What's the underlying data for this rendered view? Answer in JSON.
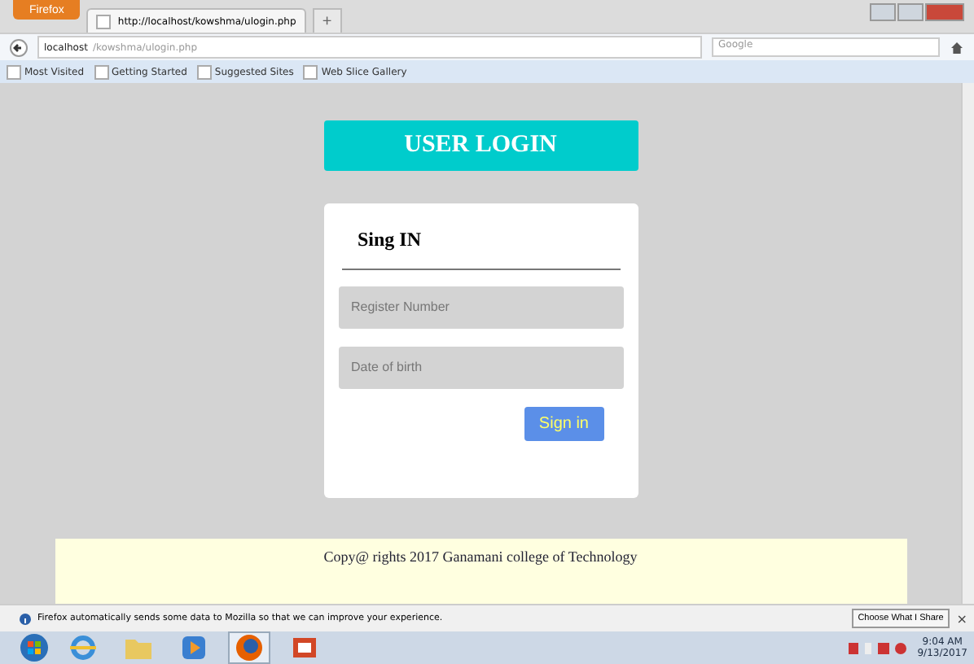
{
  "browser": {
    "menu_button": "Firefox",
    "tab": {
      "title": "http://localhost/kowshma/ulogin.php"
    },
    "new_tab": "+",
    "address": {
      "host": "localhost",
      "path": "/kowshma/ulogin.php"
    },
    "search": {
      "placeholder": "Google"
    },
    "bookmarks": [
      "Most Visited",
      "Getting Started",
      "Suggested Sites",
      "Web Slice Gallery"
    ]
  },
  "page": {
    "banner": "USER LOGIN",
    "card": {
      "heading": "Sing IN",
      "fields": [
        {
          "placeholder": "Register Number"
        },
        {
          "placeholder": "Date of birth"
        }
      ],
      "button": "Sign in"
    },
    "footer": "Copy@ rights 2017 Ganamani college of Technology"
  },
  "notification": {
    "text": "Firefox automatically sends some data to Mozilla so that we can improve your experience.",
    "button": "Choose What I Share",
    "close": "×"
  },
  "taskbar": {
    "apps": [
      {
        "kind": "ie",
        "selected": false
      },
      {
        "kind": "folder",
        "selected": false
      },
      {
        "kind": "media",
        "selected": false
      },
      {
        "kind": "firefox",
        "selected": true
      },
      {
        "kind": "slides",
        "selected": false
      }
    ],
    "time": "9:04 AM",
    "date": "9/13/2017"
  }
}
